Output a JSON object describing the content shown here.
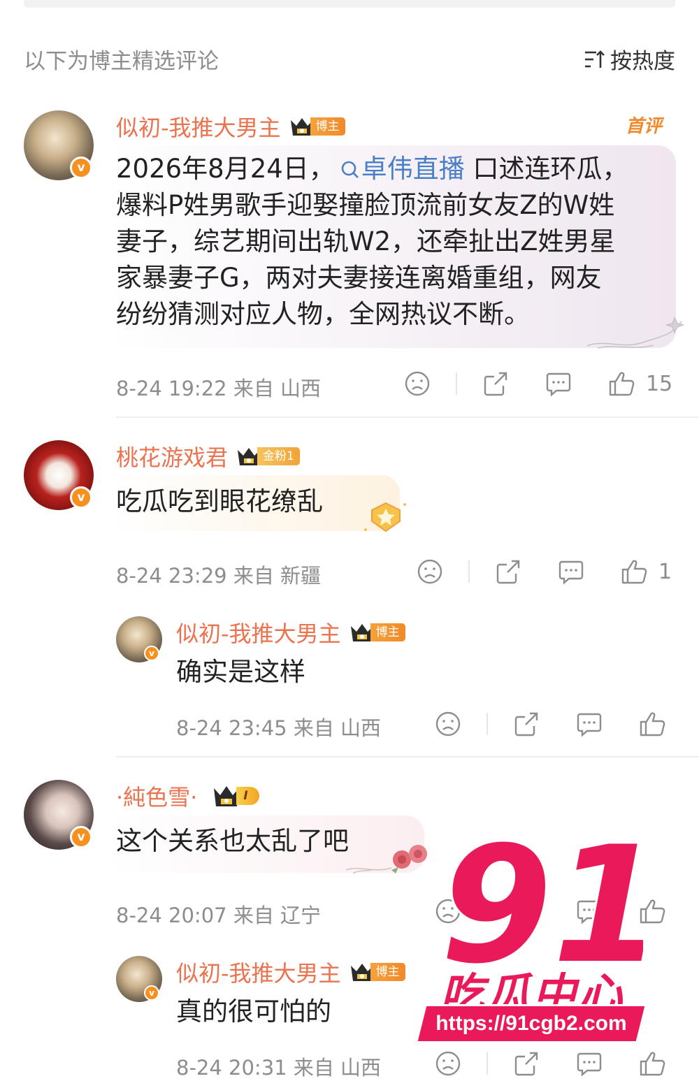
{
  "header": {
    "section_title": "以下为博主精选评论",
    "sort_label": "按热度"
  },
  "comments": [
    {
      "username": "似初-我推大男主",
      "tag": "博主",
      "first_badge": "首评",
      "text_lines": [
        "2026年8月24日，",
        "卓伟直播",
        " 口述连环瓜，",
        "爆料P姓男歌手迎娶撞脸顶流前女友Z的W姓",
        "妻子，综艺期间出轨W2，还牵扯出Z姓男星",
        "家暴妻子G，两对夫妻接连离婚重组，网友",
        "纷纷猜测对应人物，全网热议不断。"
      ],
      "meta": "8-24 19:22 来自 山西",
      "likes": "15"
    },
    {
      "username": "桃花游戏君",
      "tag": "金粉1",
      "text": "吃瓜吃到眼花缭乱",
      "meta": "8-24 23:29 来自 新疆",
      "likes": "1",
      "reply": {
        "username": "似初-我推大男主",
        "tag": "博主",
        "text": "确实是这样",
        "meta": "8-24 23:45 来自 山西"
      }
    },
    {
      "username": "·純色雪·",
      "tag": "I",
      "text": "这个关系也太乱了吧",
      "meta": "8-24 20:07 来自 辽宁",
      "reply": {
        "username": "似初-我推大男主",
        "tag": "博主",
        "text": "真的很可怕的",
        "meta": "8-24 20:31 来自 山西"
      }
    }
  ],
  "watermark": {
    "number": "91",
    "title": "吃瓜中心",
    "url": "https://91cgb2.com"
  },
  "colors": {
    "username": "#eb7350",
    "topic_link": "#4a7ec7",
    "meta": "#8d8d8d",
    "watermark": "#ea1a5a"
  }
}
